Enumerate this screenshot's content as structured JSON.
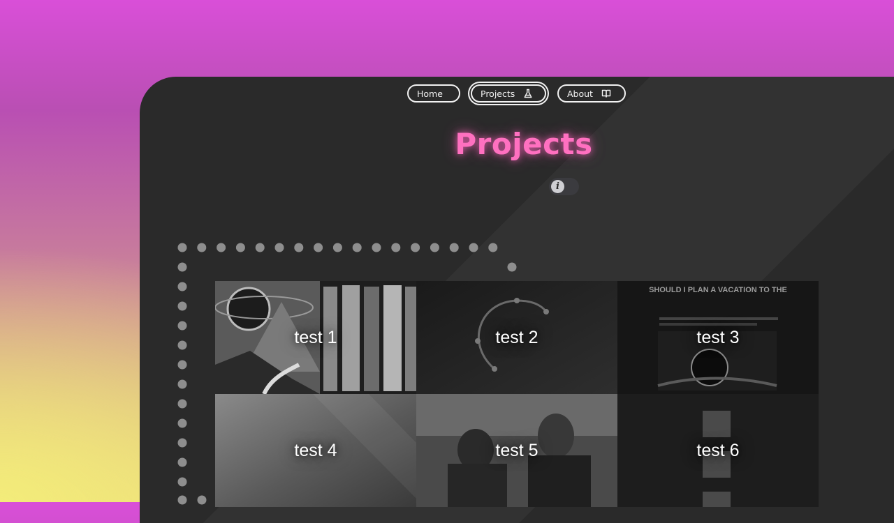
{
  "nav": {
    "items": [
      {
        "label": "Home",
        "icon": "home-glyph-icon",
        "active": false
      },
      {
        "label": "Projects",
        "icon": "flask-icon",
        "active": true
      },
      {
        "label": "About",
        "icon": "book-icon",
        "active": false
      }
    ]
  },
  "page": {
    "title": "Projects",
    "title_color": "#ff70c0",
    "info_toggle_icon": "info-icon",
    "info_toggle_glyph": "i"
  },
  "projects": [
    {
      "label": "test 1"
    },
    {
      "label": "test 2"
    },
    {
      "label": "test 3",
      "thumbnail_text": "SHOULD I PLAN A VACATION TO THE"
    },
    {
      "label": "test 4"
    },
    {
      "label": "test 5"
    },
    {
      "label": "test 6"
    }
  ],
  "colors": {
    "panel_bg": "#2a2a2a",
    "accent_pink": "#ff70c0",
    "dot": "#8e8e8e"
  }
}
